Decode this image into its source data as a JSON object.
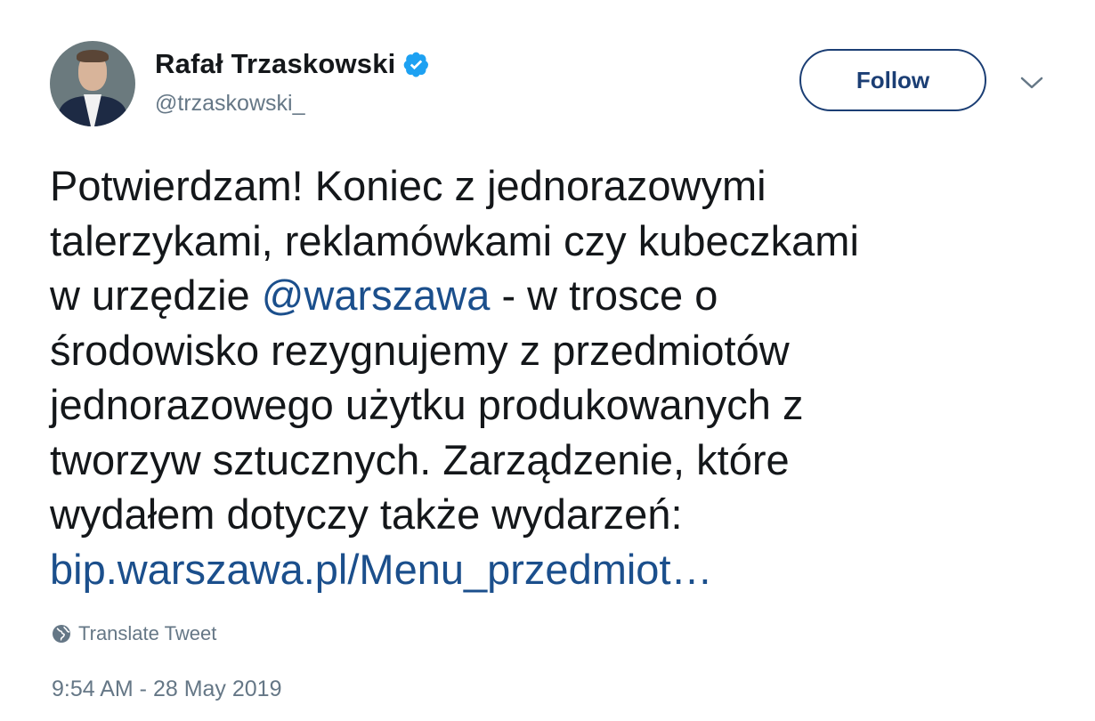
{
  "header": {
    "display_name": "Rafał Trzaskowski",
    "handle": "@trzaskowski_",
    "follow_label": "Follow",
    "verified_icon": "verified-badge-icon",
    "more_icon": "chevron-down-icon"
  },
  "tweet": {
    "line1": "Potwierdzam! Koniec z jednorazowymi",
    "line2": "talerzykami, reklamówkami czy kubeczkami",
    "line3_pre": "w urzędzie ",
    "mention": "@warszawa",
    "line3_post": " - w trosce o",
    "line4": "środowisko rezygnujemy z przedmiotów",
    "line5": "jednorazowego użytku produkowanych z",
    "line6": "tworzyw sztucznych. Zarządzenie, które",
    "line7": "wydałem dotyczy także wydarzeń:",
    "link": "bip.warszawa.pl/Menu_przedmiot…"
  },
  "translate": {
    "label": "Translate Tweet",
    "icon": "globe-icon"
  },
  "timestamp": "9:54 AM - 28 May 2019",
  "colors": {
    "accent": "#1b3e74",
    "link": "#1b4f8c",
    "verified": "#1da1f2",
    "secondary_text": "#657786"
  }
}
